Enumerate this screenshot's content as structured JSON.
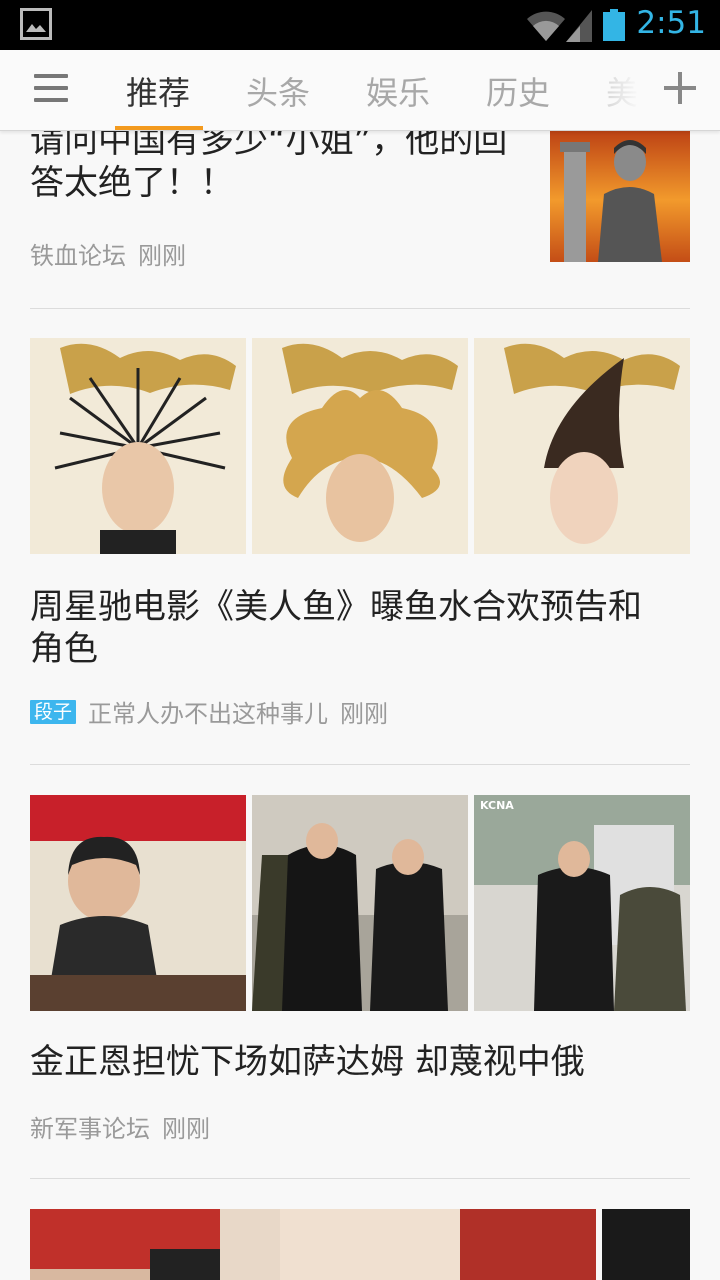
{
  "status_bar": {
    "time": "2:51"
  },
  "tabs": [
    {
      "label": "推荐",
      "active": true
    },
    {
      "label": "头条",
      "active": false
    },
    {
      "label": "娱乐",
      "active": false
    },
    {
      "label": "历史",
      "active": false
    },
    {
      "label": "美",
      "active": false
    }
  ],
  "articles": [
    {
      "title_lines": [
        "请问中国有多少“小姐”，他的回",
        "答太绝了！！"
      ],
      "source": "铁血论坛",
      "time": "刚刚"
    },
    {
      "title_lines": [
        "周星驰电影《美人鱼》曝鱼水合欢预告和",
        "角色"
      ],
      "tag": "段子",
      "source": "正常人办不出这种事儿",
      "time": "刚刚"
    },
    {
      "title_lines": [
        "金正恩担忧下场如萨达姆 却蔑视中俄"
      ],
      "source": "新军事论坛",
      "time": "刚刚"
    }
  ],
  "colors": {
    "accent": "#f39a1e",
    "tag_bg": "#3db6ee",
    "status_blue": "#33b5e5"
  },
  "icons": [
    "image-icon",
    "wifi-icon",
    "signal-icon",
    "battery-icon",
    "menu-icon",
    "add-icon"
  ]
}
